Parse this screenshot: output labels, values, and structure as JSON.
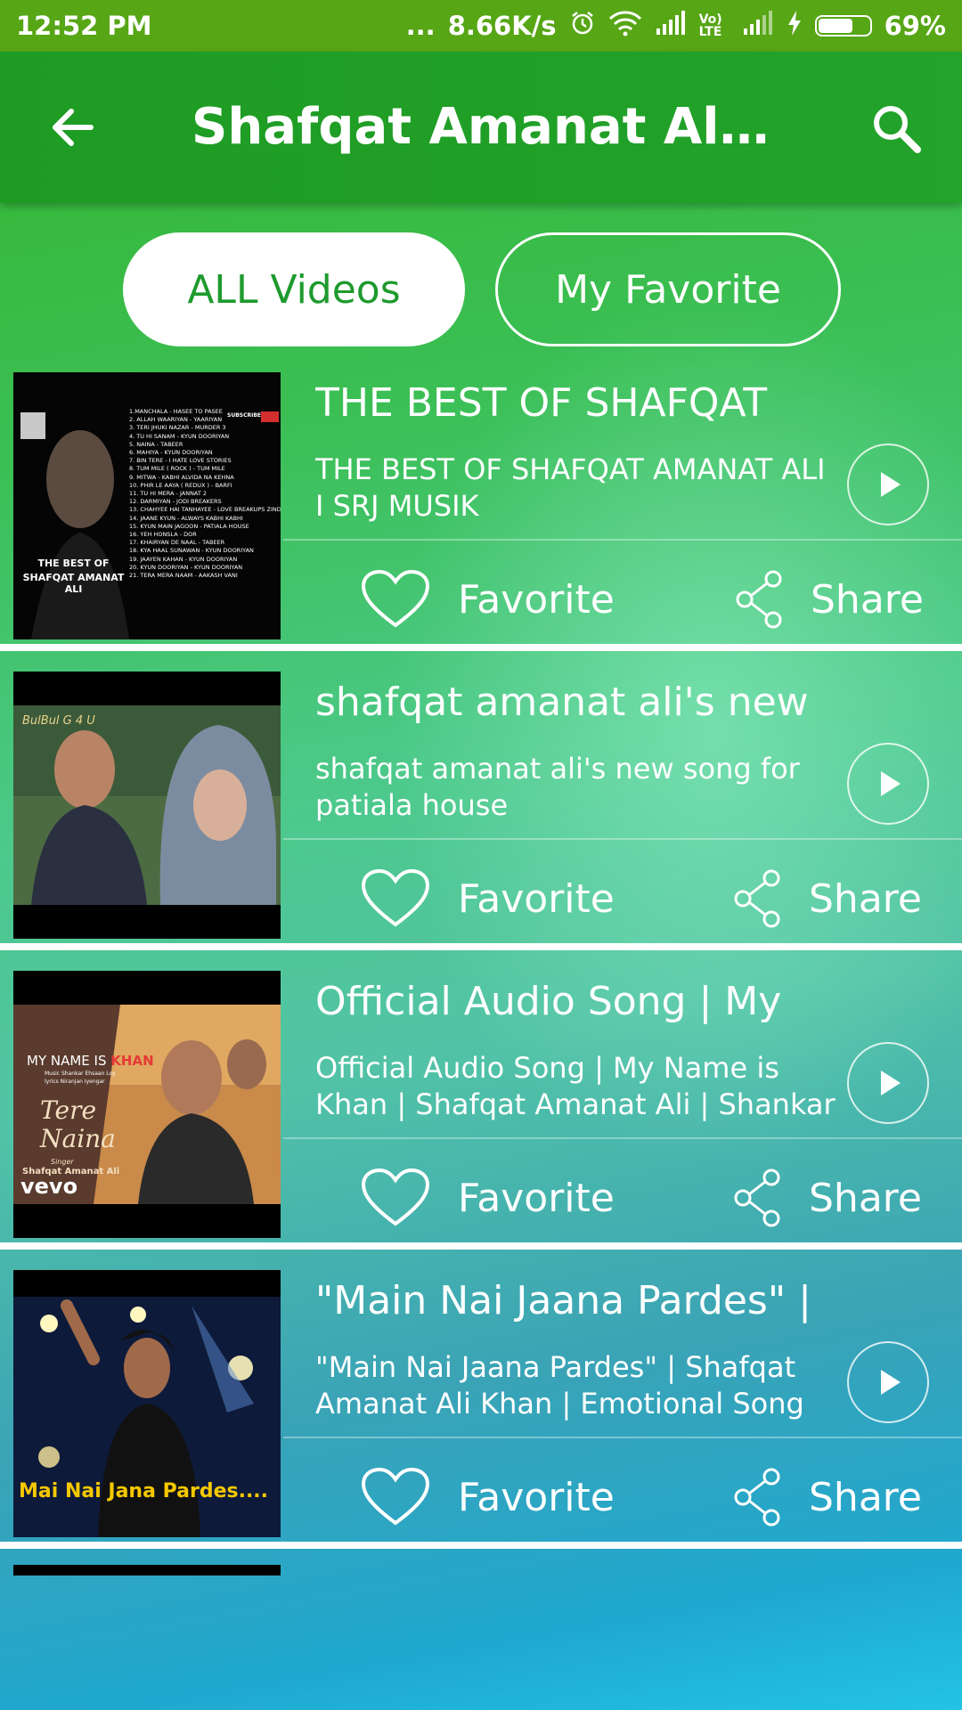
{
  "status_bar": {
    "time": "12:52 PM",
    "dots": "...",
    "network_speed": "8.66K/s",
    "lte_label": "Vo) LTE",
    "battery_percent": "69%",
    "battery_level": 0.69
  },
  "app_bar": {
    "title": "Shafqat Amanat Ali Hit...",
    "back_icon": "arrow-left-icon",
    "search_icon": "search-icon"
  },
  "tabs": [
    {
      "label": "ALL Videos",
      "selected": true
    },
    {
      "label": "My Favorite",
      "selected": false
    }
  ],
  "actions": {
    "favorite_label": "Favorite",
    "share_label": "Share"
  },
  "videos": [
    {
      "title": "THE BEST OF SHAFQAT",
      "description": "THE BEST OF SHAFQAT AMANAT ALI I SRJ MUSIK",
      "thumb_caption_1": "THE BEST OF",
      "thumb_caption_2": "SHAFQAT AMANAT ALI",
      "thumb_badge": "SUBSCRIBE",
      "thumb_tracklist": [
        "1.MANCHALA - HASEE TO PASEE",
        "2. ALLAH WAARIYAN - YAARIYAN",
        "3. TERI JHUKI NAZAR - MURDER 3",
        "4. TU HI SANAM - KYUN DOORIYAN",
        "5. NAINA - TABEER",
        "6. MAHIYA - KYUN DOORIYAN",
        "7. BIN TERE - I HATE LOVE STORIES",
        "8. TUM MILE ( ROCK ) - TUM MILE",
        "9. MITWA - KABHI ALVIDA NA KEHNA",
        "10. PHIR LE AAYA ( REDUX ) - BARFI",
        "11. TU HI MERA - JANNAT 2",
        "12. DARMIYAN - JODI BREAKERS",
        "13. CHAHYEE HAI TANHAYEE - LOVE BREAKUPS ZINDAGI",
        "14. JAANE KYUN - ALWAYS KABHI KABHI",
        "15. KYUN MAIN JAGOON - PATIALA HOUSE",
        "16. YEH HONSLA - DOR",
        "17. KHAIRYAN DE NAAL - TABEER",
        "18. KYA HAAL SUNAWAN - KYUN DOORIYAN",
        "19. JAAYEN KAHAN - KYUN DOORIYAN",
        "20. KYUN DOORIYAN - KYUN DOORIYAN",
        "21. TERA MERA NAAM - AAKASH VANI"
      ]
    },
    {
      "title": "shafqat amanat ali's new",
      "description": "shafqat amanat ali's new song for patiala house",
      "thumb_caption_1": "BulBul G 4 U"
    },
    {
      "title": "Official Audio Song | My",
      "description": "Official Audio Song | My Name is Khan | Shafqat Amanat Ali | Shankar",
      "thumb_caption_1": "MY NAME IS",
      "thumb_caption_2": "KHAN",
      "thumb_credit_1": "Music Shankar Ehsaan Loy",
      "thumb_credit_2": "lyrics Niranjan Iyengar",
      "thumb_song": "Tere",
      "thumb_song_2": "Naina",
      "thumb_singer_label": "Singer",
      "thumb_singer": "Shafqat Amanat Ali",
      "thumb_logo": "vevo"
    },
    {
      "title": "\"Main Nai Jaana Pardes\" |",
      "description": "\"Main Nai Jaana Pardes\" | Shafqat Amanat Ali Khan | Emotional Song",
      "thumb_caption_1": "Mai Nai Jana Pardes...."
    }
  ],
  "colors": {
    "status_bar": "#57a616",
    "app_bar": "#22a32a",
    "tab_selected_text": "#1e9a2e"
  }
}
